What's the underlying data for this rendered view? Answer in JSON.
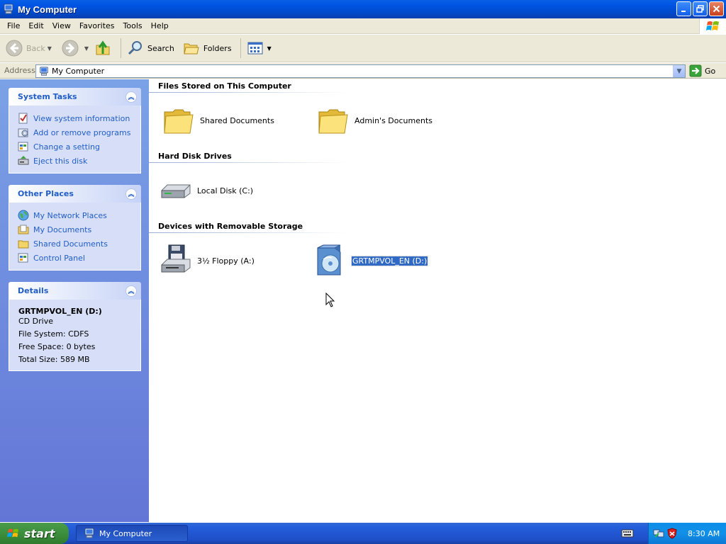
{
  "window": {
    "title": "My Computer"
  },
  "menu": [
    "File",
    "Edit",
    "View",
    "Favorites",
    "Tools",
    "Help"
  ],
  "toolbar": {
    "back_label": "Back",
    "search_label": "Search",
    "folders_label": "Folders"
  },
  "address": {
    "label": "Address",
    "value": "My Computer",
    "go_label": "Go"
  },
  "system_tasks": {
    "title": "System Tasks",
    "items": [
      {
        "label": "View system information",
        "icon": "system-info-icon"
      },
      {
        "label": "Add or remove programs",
        "icon": "add-remove-programs-icon"
      },
      {
        "label": "Change a setting",
        "icon": "control-panel-icon"
      },
      {
        "label": "Eject this disk",
        "icon": "eject-icon"
      }
    ]
  },
  "other_places": {
    "title": "Other Places",
    "items": [
      {
        "label": "My Network Places",
        "icon": "network-places-icon"
      },
      {
        "label": "My Documents",
        "icon": "my-documents-icon"
      },
      {
        "label": "Shared Documents",
        "icon": "folder-icon"
      },
      {
        "label": "Control Panel",
        "icon": "control-panel-icon"
      }
    ]
  },
  "details": {
    "title": "Details",
    "name": "GRTMPVOL_EN (D:)",
    "type": "CD Drive",
    "file_system": "File System: CDFS",
    "free_space": "Free Space: 0 bytes",
    "total_size": "Total Size: 589 MB"
  },
  "groups": {
    "files_stored": {
      "title": "Files Stored on This Computer",
      "items": [
        {
          "label": "Shared Documents",
          "icon": "folder-icon"
        },
        {
          "label": "Admin's Documents",
          "icon": "folder-icon"
        }
      ]
    },
    "hard_disks": {
      "title": "Hard Disk Drives",
      "items": [
        {
          "label": "Local Disk (C:)",
          "icon": "hard-disk-icon"
        }
      ]
    },
    "removable": {
      "title": "Devices with Removable Storage",
      "items": [
        {
          "label": "3½ Floppy (A:)",
          "icon": "floppy-drive-icon"
        },
        {
          "label": "GRTMPVOL_EN (D:)",
          "icon": "cd-drive-icon",
          "selected": true
        }
      ]
    }
  },
  "taskbar": {
    "start_label": "start",
    "task_label": "My Computer",
    "clock": "8:30 AM"
  },
  "colors": {
    "title_bar": "#0054e3",
    "left_pane": "#6f8fdf",
    "task_link": "#215dc6",
    "selection": "#316ac5",
    "start_button": "#3c8f3c"
  }
}
